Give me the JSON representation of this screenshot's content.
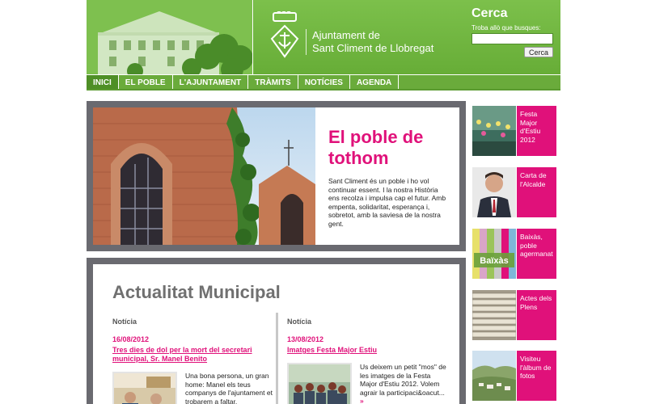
{
  "header": {
    "brand_line1": "Ajuntament de",
    "brand_line2": "Sant Climent de Llobregat",
    "search_title": "Cerca",
    "search_hint": "Troba allò que busques:",
    "search_value": "",
    "search_button": "Cerca"
  },
  "nav": {
    "items": [
      "INICI",
      "EL POBLE",
      "L'AJUNTAMENT",
      "TRÀMITS",
      "NOTÍCIES",
      "AGENDA"
    ],
    "active": "INICI"
  },
  "hero": {
    "title": "El poble de tothom",
    "text": "Sant Climent és un poble i ho vol continuar essent. I la nostra Història ens recolza i impulsa cap el futur. Amb empenta, solidaritat, esperança i, sobretot, amb la saviesa de la nostra gent."
  },
  "news": {
    "title": "Actualitat Municipal",
    "items": [
      {
        "kind": "Notícia",
        "date": "16/08/2012",
        "headline": "Tres dies de dol per la mort del secretari municipal, Sr. Manel Benito",
        "text": "Una bona persona, un gran home: Manel els teus companys de l'ajuntament et trobarem a faltar."
      },
      {
        "kind": "Notícia",
        "date": "13/08/2012",
        "headline": "Imatges Festa Major Estiu",
        "text": "Us deixem un petit \"mos\" de les imatges de la Festa Major d'Estiu 2012. Volem agrair la participaci&oacut...",
        "more": "»"
      }
    ]
  },
  "sidebar": {
    "items": [
      {
        "label": "Festa Major d'Estiu 2012",
        "icon": "festa-photo"
      },
      {
        "label": "Carta de l'Alcalde",
        "icon": "mayor-photo"
      },
      {
        "label": "Baixàs, poble agermanat",
        "icon": "baixas-logo"
      },
      {
        "label": "Actes dels Plens",
        "icon": "documents-photo"
      },
      {
        "label": "Visiteu l'àlbum de fotos",
        "icon": "landscape-photo"
      }
    ],
    "baixas_logo_text": "Baïxàs"
  },
  "colors": {
    "green": "#6db33f",
    "magenta": "#e0117a",
    "frame_gray": "#6a6a70"
  }
}
